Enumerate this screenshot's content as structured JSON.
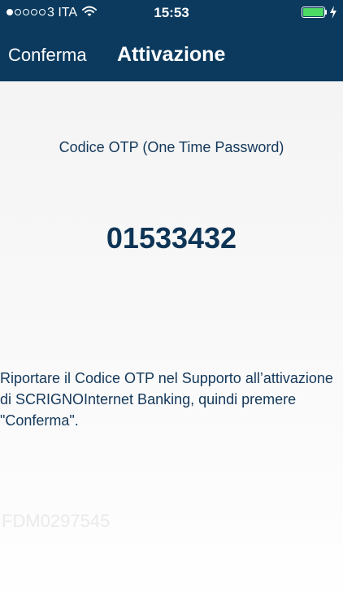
{
  "status_bar": {
    "carrier": "3 ITA",
    "time": "15:53",
    "signal_bars_filled": 1,
    "signal_bars_total": 5,
    "battery_level": 1.0,
    "battery_color": "#4cd964",
    "icons": [
      "wifi-icon",
      "battery-icon",
      "charging-icon"
    ]
  },
  "nav": {
    "confirm_label": "Conferma",
    "title": "Attivazione",
    "background": "#0b3a5e"
  },
  "otp": {
    "caption": "Codice OTP (One Time Password)",
    "code": "01533432"
  },
  "instructions": "Riportare il Codice OTP nel Supporto all’attivazione di SCRIGNOInternet Banking, quindi premere \"Conferma\".",
  "device_id": "FDM0297545"
}
